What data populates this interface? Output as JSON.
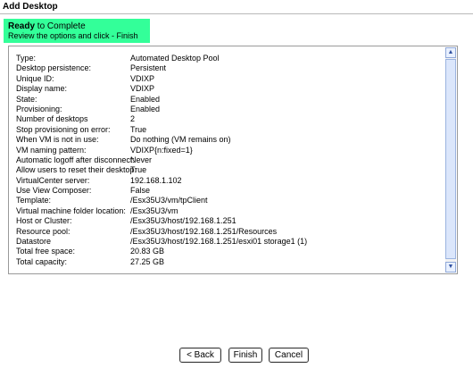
{
  "window": {
    "title": "Add Desktop"
  },
  "header": {
    "title_bold": "Ready",
    "title_rest": " to Complete",
    "subtitle": "Review the options and click - Finish"
  },
  "summary": {
    "rows": [
      {
        "label": "Type:",
        "value": "Automated Desktop Pool"
      },
      {
        "label": "Desktop persistence:",
        "value": "Persistent"
      },
      {
        "label": "Unique ID:",
        "value": "VDIXP"
      },
      {
        "label": "Display name:",
        "value": "VDIXP"
      },
      {
        "label": "State:",
        "value": "Enabled"
      },
      {
        "label": "Provisioning:",
        "value": "Enabled"
      },
      {
        "label": "Number of desktops",
        "value": "2"
      },
      {
        "label": "Stop provisioning on error:",
        "value": "True"
      },
      {
        "label": "When VM is not in use:",
        "value": "Do nothing (VM remains on)"
      },
      {
        "label": "VM naming pattern:",
        "value": "VDIXP{n:fixed=1}"
      },
      {
        "label": "Automatic logoff after disconnect:",
        "value": "Never"
      },
      {
        "label": "Allow users to reset their desktop:",
        "value": "True"
      },
      {
        "label": "VirtualCenter server:",
        "value": "192.168.1.102"
      },
      {
        "label": "Use View Composer:",
        "value": "False"
      },
      {
        "label": "Template:",
        "value": "/Esx35U3/vm/tpClient"
      },
      {
        "label": "Virtual machine folder location:",
        "value": "/Esx35U3/vm"
      },
      {
        "label": "Host or Cluster:",
        "value": "/Esx35U3/host/192.168.1.251"
      },
      {
        "label": "Resource pool:",
        "value": "/Esx35U3/host/192.168.1.251/Resources"
      },
      {
        "label": "Datastore",
        "value": "/Esx35U3/host/192.168.1.251/esxi01 storage1 (1)"
      },
      {
        "label": "Total free space:",
        "value": "20.83 GB"
      },
      {
        "label": "Total capacity:",
        "value": "27.25 GB"
      }
    ]
  },
  "scrollbar": {
    "up_icon": "▲",
    "down_icon": "▼"
  },
  "buttons": {
    "back": "< Back",
    "finish": "Finish",
    "cancel": "Cancel"
  }
}
